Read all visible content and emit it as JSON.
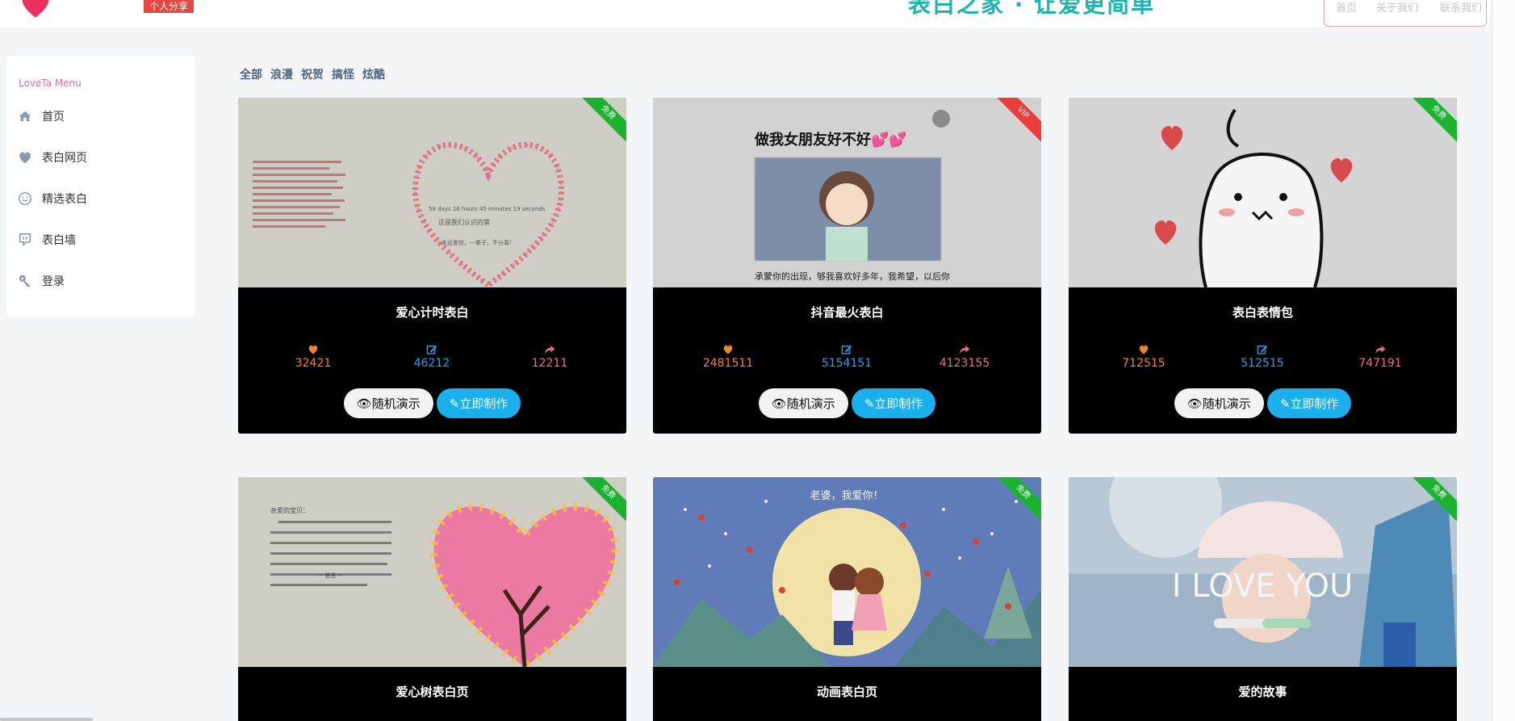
{
  "header": {
    "tag": "个人分享",
    "banner": "表白之家 · 让爱更简单",
    "nav": [
      "首页",
      "关于我们",
      "联系我们"
    ]
  },
  "sidebar": {
    "title": "LoveTa Menu",
    "items": [
      {
        "label": "首页",
        "icon": "home-icon"
      },
      {
        "label": "表白网页",
        "icon": "heart-icon"
      },
      {
        "label": "精选表白",
        "icon": "smile-icon"
      },
      {
        "label": "表白墙",
        "icon": "chat-icon"
      },
      {
        "label": "登录",
        "icon": "key-icon"
      }
    ]
  },
  "filters": [
    "全部",
    "浪漫",
    "祝贺",
    "搞怪",
    "炫酷"
  ],
  "buttons": {
    "demo": "随机演示",
    "make": "立即制作"
  },
  "cards": [
    {
      "title": "爱心计时表白",
      "badge": "免费",
      "likes": "32421",
      "edits": "46212",
      "shares": "12211"
    },
    {
      "title": "抖音最火表白",
      "badge": "VIP",
      "likes": "2481511",
      "edits": "5154151",
      "shares": "4123155"
    },
    {
      "title": "表白表情包",
      "badge": "免费",
      "likes": "712515",
      "edits": "512515",
      "shares": "747191"
    },
    {
      "title": "爱心树表白页",
      "badge": "免费"
    },
    {
      "title": "动画表白页",
      "badge": "免费"
    },
    {
      "title": "爱的故事",
      "badge": "免费"
    }
  ],
  "card_images": {
    "c1": {
      "heading": "这是我们认识的第",
      "counter": "58 days 16 hours 45 minutes 19 seconds",
      "footer": "永远爱你，一辈子，不分离！"
    },
    "c2": {
      "heading": "做我女朋友好不好💕💕",
      "caption": "承蒙你的出现，够我喜欢好多年，我希望，以后你"
    },
    "c4": {
      "heading": "亲爱的宝贝：",
      "sign": "-- 爸爸 --"
    },
    "c5": {
      "heading": "老婆，我爱你！"
    },
    "c6": {
      "heading": "I LOVE YOU"
    }
  },
  "colors": {
    "likes": "#f08428",
    "edits": "#2a9ee8",
    "shares": "#f06a8a",
    "accent": "#1ab0ee",
    "free": "#19b32e",
    "vip": "#ee3b3b"
  }
}
